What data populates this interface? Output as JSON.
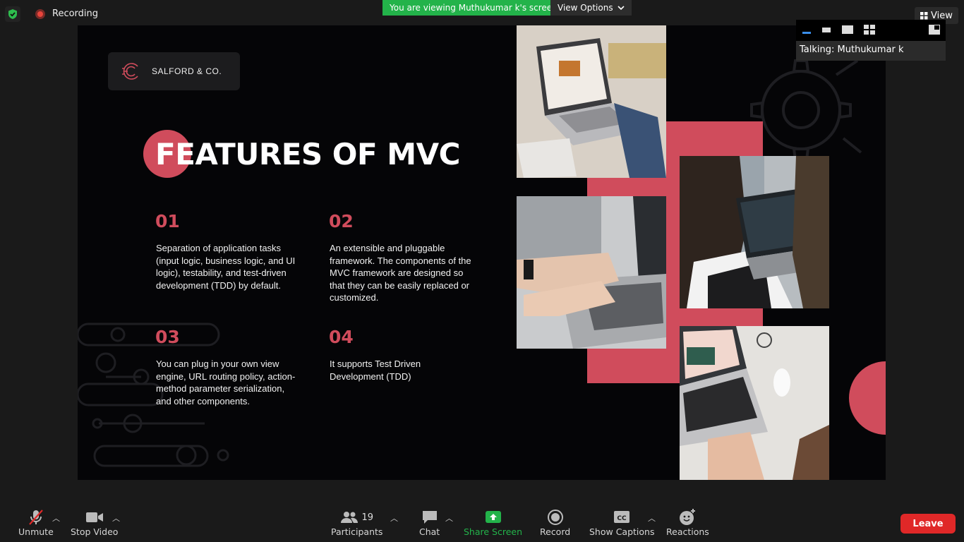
{
  "topbar": {
    "recording_label": "Recording",
    "viewing_banner": "You are viewing Muthukumar k's screen",
    "view_options_label": "View Options",
    "view_label": "View"
  },
  "thumbnail_panel": {
    "talking_label": "Talking: Muthukumar k"
  },
  "slide": {
    "logo_text": "SALFORD & CO.",
    "title": "FEATURES OF MVC",
    "features": [
      {
        "number": "01",
        "text": "Separation of application tasks (input logic, business logic, and UI logic), testability, and test-driven development (TDD) by default."
      },
      {
        "number": "02",
        "text": "An extensible and pluggable framework. The components of the MVC framework are designed so that they can be easily replaced or customized."
      },
      {
        "number": "03",
        "text": "You can plug in your own view engine, URL routing policy, action-method parameter serialization, and other components."
      },
      {
        "number": "04",
        "text": "It supports Test Driven Development (TDD)"
      }
    ],
    "accent_color": "#d04c5c"
  },
  "toolbar": {
    "unmute": "Unmute",
    "stop_video": "Stop Video",
    "participants": "Participants",
    "participants_count": "19",
    "chat": "Chat",
    "share_screen": "Share Screen",
    "record": "Record",
    "show_captions": "Show Captions",
    "reactions": "Reactions",
    "leave": "Leave",
    "leave_color": "#e02828",
    "share_color": "#23b34a"
  }
}
